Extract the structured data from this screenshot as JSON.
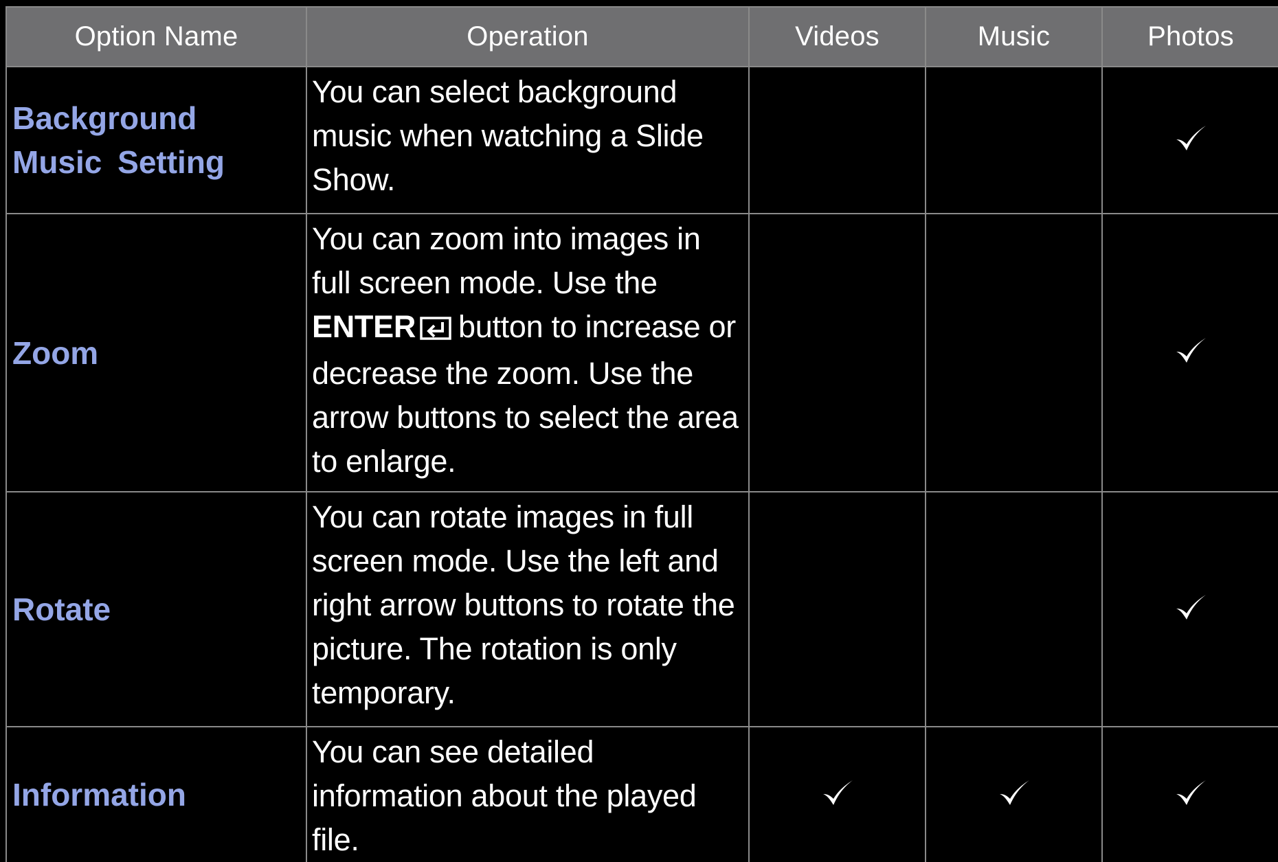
{
  "table": {
    "headers": {
      "option_name": "Option Name",
      "operation": "Operation",
      "videos": "Videos",
      "music": "Music",
      "photos": "Photos"
    },
    "rows": [
      {
        "name": "Background Music Setting",
        "operation": "You can select background music when watching a Slide Show.",
        "videos": false,
        "music": false,
        "photos": true
      },
      {
        "name": "Zoom",
        "operation_pre": "You can zoom into images in full screen mode. Use the",
        "operation_key": "ENTER",
        "operation_post": "button to increase or decrease the zoom. Use the arrow buttons to select the area to enlarge.",
        "videos": false,
        "music": false,
        "photos": true
      },
      {
        "name": "Rotate",
        "operation": "You can rotate images in full screen mode. Use the left and right arrow buttons to rotate the picture. The rotation is only temporary.",
        "videos": false,
        "music": false,
        "photos": true
      },
      {
        "name": "Information",
        "operation": "You can see detailed information about the played file.",
        "videos": true,
        "music": true,
        "photos": true
      }
    ]
  },
  "icons": {
    "check": "checkmark-icon",
    "enter": "enter-key-icon"
  },
  "colors": {
    "background": "#000000",
    "header_bg": "#6f6f71",
    "option_name_text": "#94a6e6",
    "body_text": "#ffffff",
    "grid_line": "#8a8a8a"
  }
}
